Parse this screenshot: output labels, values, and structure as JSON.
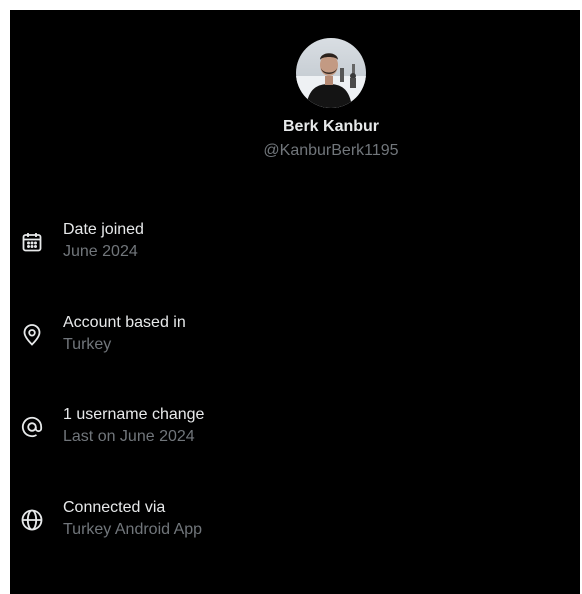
{
  "profile": {
    "name": "Berk Kanbur",
    "handle": "@KanburBerk1195",
    "avatar_icon": "profile-photo"
  },
  "rows": [
    {
      "icon": "calendar-icon",
      "title": "Date joined",
      "subtitle": "June 2024"
    },
    {
      "icon": "location-pin-icon",
      "title": "Account based in",
      "subtitle": "Turkey"
    },
    {
      "icon": "at-sign-icon",
      "title": "1 username change",
      "subtitle": "Last on June 2024"
    },
    {
      "icon": "globe-icon",
      "title": "Connected via",
      "subtitle": "Turkey Android App"
    }
  ],
  "colors": {
    "background": "#000000",
    "primary_text": "#e7e9ea",
    "secondary_text": "#71767b"
  }
}
